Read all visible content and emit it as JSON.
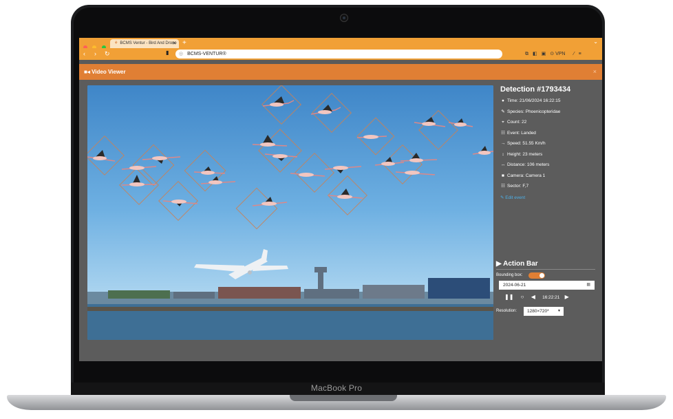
{
  "device": {
    "brand": "MacBook Pro"
  },
  "browser": {
    "tab_title": "BCMS Ventur - Bird And Drone",
    "tab_icon": "bird-logo-icon",
    "new_tab": "+",
    "url": "BCMS-VENTUR®",
    "toolbar": {
      "vpn_label": "VPN"
    }
  },
  "modal": {
    "title": "Video Viewer",
    "close": "×"
  },
  "detection": {
    "title": "Detection #1793434",
    "time": "Time: 21/06/2024 16:22:15",
    "species": "Species: Phoenicopteridae",
    "count": "Count: 22",
    "event": "Event: Landed",
    "speed": "Speed: 51.55 Km/h",
    "height": "Height: 23 meters",
    "distance": "Distance: 106 meters",
    "camera": "Camera: Camera 1",
    "sector": "Sector: F,7",
    "edit_link": "Edit event"
  },
  "action_bar": {
    "title": "Action Bar",
    "bounding_box_label": "Bounding box:",
    "bounding_box_on": true,
    "date": "2024-06-21",
    "time": "16:22:21",
    "resolution_label": "Resolution:",
    "resolution_value": "1280×720*"
  },
  "colors": {
    "accent": "#e07f34",
    "browser_bar": "#f1a036",
    "link": "#4db0e8",
    "panel_bg": "#5c5c5c"
  }
}
